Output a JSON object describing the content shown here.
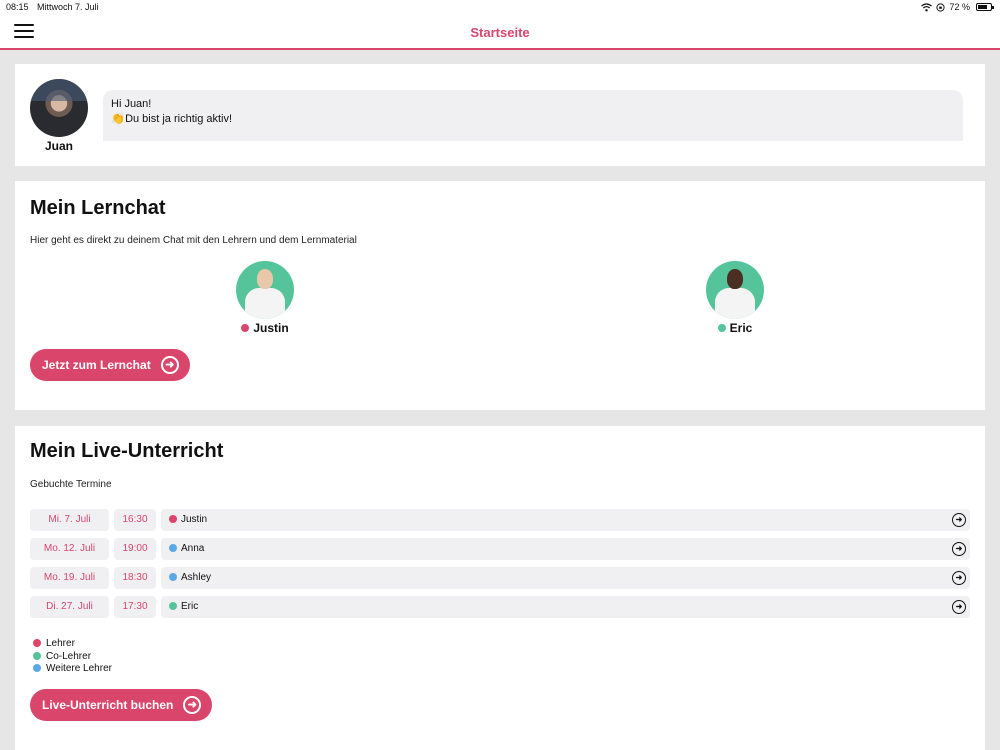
{
  "status": {
    "time": "08:15",
    "date": "Mittwoch 7. Juli",
    "battery": "72 %",
    "battery_level": 0.72
  },
  "nav": {
    "title": "Startseite"
  },
  "greeting": {
    "user_name": "Juan",
    "line1": "Hi Juan!",
    "clap": "👏",
    "line2": "Du bist ja richtig aktiv!"
  },
  "lernchat": {
    "title": "Mein Lernchat",
    "description": "Hier geht es direkt zu deinem Chat mit den Lehrern und dem Lernmaterial",
    "teachers": [
      {
        "name": "Justin",
        "role_color": "#d9456b",
        "skin": "#e8c8a8"
      },
      {
        "name": "Eric",
        "role_color": "#55c49a",
        "skin": "#4a2f22"
      }
    ],
    "button_label": "Jetzt zum Lernchat"
  },
  "live": {
    "title": "Mein Live-Unterricht",
    "subtitle": "Gebuchte Termine",
    "appointments": [
      {
        "date": "Mi. 7. Juli",
        "time": "16:30",
        "teacher": "Justin",
        "color": "#d9456b"
      },
      {
        "date": "Mo. 12. Juli",
        "time": "19:00",
        "teacher": "Anna",
        "color": "#5aa9e6"
      },
      {
        "date": "Mo. 19. Juli",
        "time": "18:30",
        "teacher": "Ashley",
        "color": "#5aa9e6"
      },
      {
        "date": "Di. 27. Juli",
        "time": "17:30",
        "teacher": "Eric",
        "color": "#55c49a"
      }
    ],
    "legend": [
      {
        "label": "Lehrer",
        "color": "#d9456b"
      },
      {
        "label": "Co-Lehrer",
        "color": "#55c49a"
      },
      {
        "label": "Weitere Lehrer",
        "color": "#5aa9e6"
      }
    ],
    "button_label": "Live-Unterricht buchen"
  },
  "colors": {
    "accent": "#d9456b",
    "bubble": "#f0f0f2"
  }
}
